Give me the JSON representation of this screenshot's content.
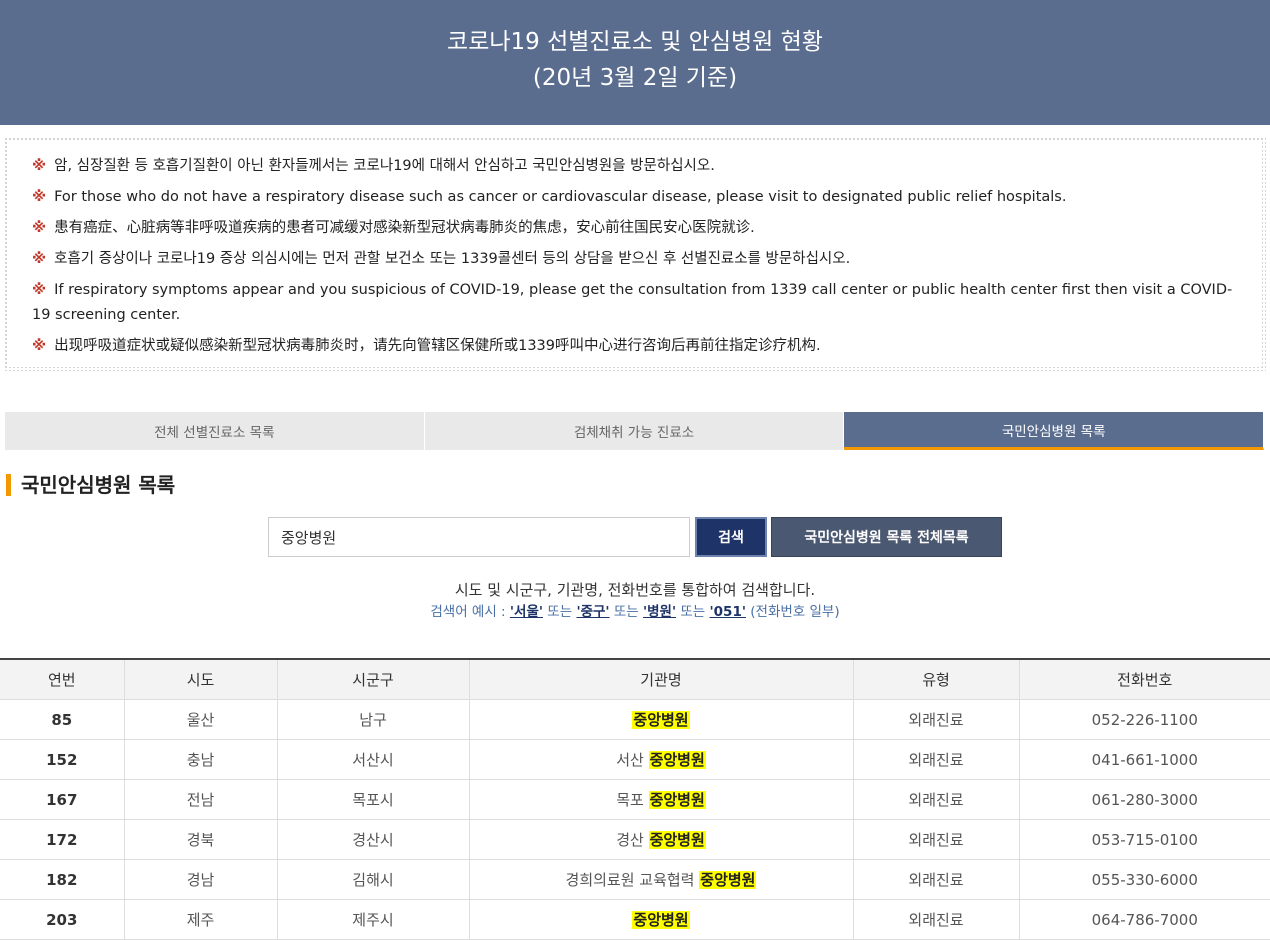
{
  "header": {
    "title": "코로나19 선별진료소 및 안심병원 현황",
    "subtitle": "(20년 3월 2일 기준)"
  },
  "notices": [
    {
      "mark": "※",
      "text": "암, 심장질환 등 호흡기질환이 아닌 환자들께서는 코로나19에 대해서 안심하고 국민안심병원을 방문하십시오."
    },
    {
      "mark": "※",
      "text": "For those who do not have a respiratory disease such as cancer or cardiovascular disease, please visit to designated public relief hospitals."
    },
    {
      "mark": "※",
      "text": "患有癌症、心脏病等非呼吸道疾病的患者可减缓对感染新型冠状病毒肺炎的焦虑，安心前往国民安心医院就诊."
    },
    {
      "mark": "※",
      "text": "호흡기 증상이나 코로나19 증상 의심시에는 먼저 관할 보건소 또는 1339콜센터 등의 상담을 받으신 후 선별진료소를 방문하십시오."
    },
    {
      "mark": "※",
      "text": "If respiratory symptoms appear and you suspicious of COVID-19, please get the consultation from 1339 call center or public health center first then visit a COVID-19 screening center."
    },
    {
      "mark": "※",
      "text": "出现呼吸道症状或疑似感染新型冠状病毒肺炎时，请先向管辖区保健所或1339呼叫中心进行咨询后再前往指定诊疗机构."
    }
  ],
  "tabs": [
    {
      "label": "전체 선별진료소 목록",
      "active": false
    },
    {
      "label": "검체채취 가능 진료소",
      "active": false
    },
    {
      "label": "국민안심병원 목록",
      "active": true
    }
  ],
  "section_title": "국민안심병원 목록",
  "search": {
    "value": "중앙병원",
    "button": "검색",
    "all_button": "국민안심병원 목록 전체목록"
  },
  "help": {
    "line1": "시도 및 시군구, 기관명, 전화번호를 통합하여 검색합니다.",
    "prefix": "검색어 예시 : ",
    "examples": [
      "'서울'",
      "'중구'",
      "'병원'",
      "'051'"
    ],
    "sep1": " 또는 ",
    "sep2": " 또는 ",
    "sep3": " 또는 ",
    "suffix": " (전화번호 일부)"
  },
  "table": {
    "headers": [
      "연번",
      "시도",
      "시군구",
      "기관명",
      "유형",
      "전화번호"
    ],
    "rows": [
      {
        "no": "85",
        "sido": "울산",
        "sigungu": "남구",
        "name_prefix": "",
        "name_hl": "중앙병원",
        "type": "외래진료",
        "phone": "052-226-1100"
      },
      {
        "no": "152",
        "sido": "충남",
        "sigungu": "서산시",
        "name_prefix": "서산 ",
        "name_hl": "중앙병원",
        "type": "외래진료",
        "phone": "041-661-1000"
      },
      {
        "no": "167",
        "sido": "전남",
        "sigungu": "목포시",
        "name_prefix": "목포 ",
        "name_hl": "중앙병원",
        "type": "외래진료",
        "phone": "061-280-3000"
      },
      {
        "no": "172",
        "sido": "경북",
        "sigungu": "경산시",
        "name_prefix": "경산 ",
        "name_hl": "중앙병원",
        "type": "외래진료",
        "phone": "053-715-0100"
      },
      {
        "no": "182",
        "sido": "경남",
        "sigungu": "김해시",
        "name_prefix": "경희의료원 교육협력 ",
        "name_hl": "중앙병원",
        "type": "외래진료",
        "phone": "055-330-6000"
      },
      {
        "no": "203",
        "sido": "제주",
        "sigungu": "제주시",
        "name_prefix": "",
        "name_hl": "중앙병원",
        "type": "외래진료",
        "phone": "064-786-7000"
      }
    ]
  },
  "colors": {
    "header_bg": "#5a6d8e",
    "accent": "#f39800",
    "search_btn": "#1e3468",
    "highlight": "#ffff00"
  }
}
